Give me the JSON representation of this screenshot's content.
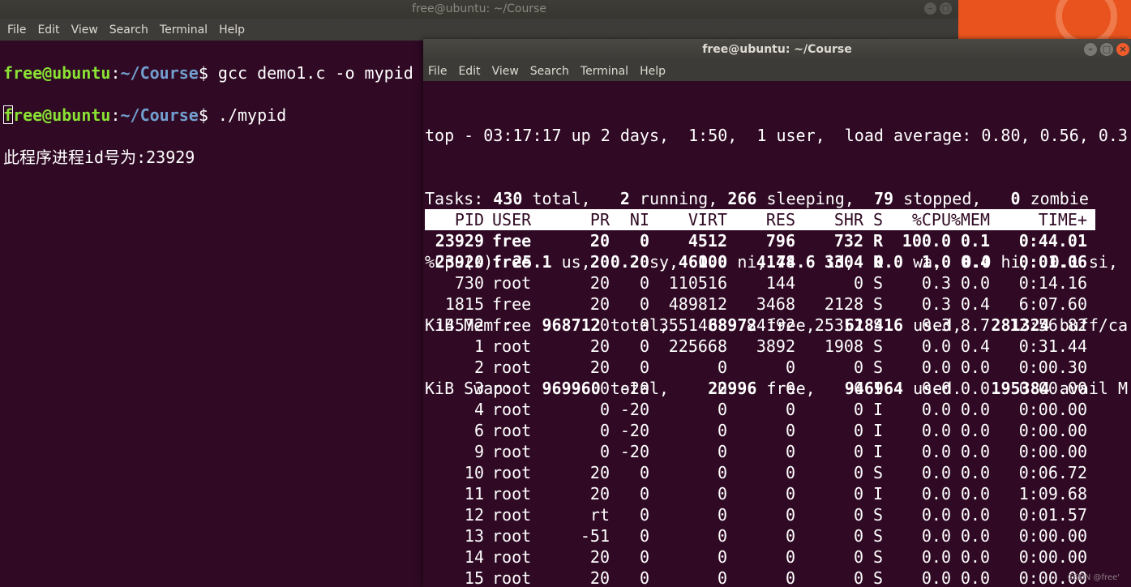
{
  "back_window": {
    "title": "free@ubuntu: ~/Course",
    "menu": [
      "File",
      "Edit",
      "View",
      "Search",
      "Terminal",
      "Help"
    ],
    "lines": [
      {
        "user": "free@ubuntu",
        "sep": ":",
        "path": "~/Course",
        "prompt": "$ ",
        "cmd": "gcc demo1.c -o mypid"
      },
      {
        "user": "free@ubuntu",
        "sep": ":",
        "path": "~/Course",
        "prompt": "$ ",
        "cmd": "./mypid"
      }
    ],
    "output": "此程序进程id号为:23929"
  },
  "front_window": {
    "title": "free@ubuntu: ~/Course",
    "menu": [
      "File",
      "Edit",
      "View",
      "Search",
      "Terminal",
      "Help"
    ],
    "summary": {
      "line1": "top - 03:17:17 up 2 days,  1:50,  1 user,  load average: 0.80, 0.56, 0.3",
      "tasks": {
        "prefix": "Tasks: ",
        "total": "430",
        "t_label": " total,   ",
        "running": "2",
        "r_label": " running, ",
        "sleeping": "266",
        "s_label": " sleeping,  ",
        "stopped": "79",
        "st_label": " stopped,   ",
        "zombie": "0",
        "z_label": " zombie"
      },
      "cpu": {
        "prefix": "%Cpu(s): ",
        "us": "25.1",
        "us_label": " us,  ",
        "sy": "0.2",
        "sy_label": " sy,  ",
        "ni": "0.0",
        "ni_label": " ni, ",
        "id": "74.6",
        "id_label": " id,  ",
        "wa": "0.0",
        "wa_label": " wa,  ",
        "hi": "0.0",
        "hi_label": " hi,  ",
        "si": "0.1",
        "si_label": " si,"
      },
      "mem": {
        "prefix": "KiB Mem :   ",
        "total": "968712",
        "t_label": " total,    ",
        "free": "68972",
        "f_label": " free,   ",
        "used": "618416",
        "u_label": " used,   ",
        "buff": "281324",
        "b_label": " buff/ca"
      },
      "swap": {
        "prefix": "KiB Swap:   ",
        "total": "969960",
        "t_label": " total,    ",
        "free": "22996",
        "f_label": " free,   ",
        "used": "946964",
        "u_label": " used.   ",
        "avail": "195384",
        "a_label": " avail M"
      }
    },
    "columns": [
      "PID",
      "USER",
      "PR",
      "NI",
      "VIRT",
      "RES",
      "SHR",
      "S",
      "%CPU",
      "%MEM",
      "TIME+"
    ],
    "processes": [
      {
        "pid": "23929",
        "user": "free",
        "pr": "20",
        "ni": "0",
        "virt": "4512",
        "res": "796",
        "shr": "732",
        "s": "R",
        "cpu": "100.0",
        "mem": "0.1",
        "time": "0:44.01",
        "bold": true
      },
      {
        "pid": "23920",
        "user": "free",
        "pr": "20",
        "ni": "0",
        "virt": "46100",
        "res": "4148",
        "shr": "3304",
        "s": "R",
        "cpu": "1.0",
        "mem": "0.4",
        "time": "0:01.06",
        "bold": true
      },
      {
        "pid": "730",
        "user": "root",
        "pr": "20",
        "ni": "0",
        "virt": "110516",
        "res": "144",
        "shr": "0",
        "s": "S",
        "cpu": "0.3",
        "mem": "0.0",
        "time": "0:14.16",
        "bold": false
      },
      {
        "pid": "1815",
        "user": "free",
        "pr": "20",
        "ni": "0",
        "virt": "489812",
        "res": "3468",
        "shr": "2128",
        "s": "S",
        "cpu": "0.3",
        "mem": "0.4",
        "time": "6:07.60",
        "bold": false
      },
      {
        "pid": "14572",
        "user": "free",
        "pr": "20",
        "ni": "0",
        "virt": "3551488",
        "res": "84192",
        "shr": "25352",
        "s": "S",
        "cpu": "0.3",
        "mem": "8.7",
        "time": "12:56.82",
        "bold": false
      },
      {
        "pid": "1",
        "user": "root",
        "pr": "20",
        "ni": "0",
        "virt": "225668",
        "res": "3892",
        "shr": "1908",
        "s": "S",
        "cpu": "0.0",
        "mem": "0.4",
        "time": "0:31.44",
        "bold": false
      },
      {
        "pid": "2",
        "user": "root",
        "pr": "20",
        "ni": "0",
        "virt": "0",
        "res": "0",
        "shr": "0",
        "s": "S",
        "cpu": "0.0",
        "mem": "0.0",
        "time": "0:00.30",
        "bold": false
      },
      {
        "pid": "3",
        "user": "root",
        "pr": "0",
        "ni": "-20",
        "virt": "0",
        "res": "0",
        "shr": "0",
        "s": "I",
        "cpu": "0.0",
        "mem": "0.0",
        "time": "0:00.00",
        "bold": false
      },
      {
        "pid": "4",
        "user": "root",
        "pr": "0",
        "ni": "-20",
        "virt": "0",
        "res": "0",
        "shr": "0",
        "s": "I",
        "cpu": "0.0",
        "mem": "0.0",
        "time": "0:00.00",
        "bold": false
      },
      {
        "pid": "6",
        "user": "root",
        "pr": "0",
        "ni": "-20",
        "virt": "0",
        "res": "0",
        "shr": "0",
        "s": "I",
        "cpu": "0.0",
        "mem": "0.0",
        "time": "0:00.00",
        "bold": false
      },
      {
        "pid": "9",
        "user": "root",
        "pr": "0",
        "ni": "-20",
        "virt": "0",
        "res": "0",
        "shr": "0",
        "s": "I",
        "cpu": "0.0",
        "mem": "0.0",
        "time": "0:00.00",
        "bold": false
      },
      {
        "pid": "10",
        "user": "root",
        "pr": "20",
        "ni": "0",
        "virt": "0",
        "res": "0",
        "shr": "0",
        "s": "S",
        "cpu": "0.0",
        "mem": "0.0",
        "time": "0:06.72",
        "bold": false
      },
      {
        "pid": "11",
        "user": "root",
        "pr": "20",
        "ni": "0",
        "virt": "0",
        "res": "0",
        "shr": "0",
        "s": "I",
        "cpu": "0.0",
        "mem": "0.0",
        "time": "1:09.68",
        "bold": false
      },
      {
        "pid": "12",
        "user": "root",
        "pr": "rt",
        "ni": "0",
        "virt": "0",
        "res": "0",
        "shr": "0",
        "s": "S",
        "cpu": "0.0",
        "mem": "0.0",
        "time": "0:01.57",
        "bold": false
      },
      {
        "pid": "13",
        "user": "root",
        "pr": "-51",
        "ni": "0",
        "virt": "0",
        "res": "0",
        "shr": "0",
        "s": "S",
        "cpu": "0.0",
        "mem": "0.0",
        "time": "0:00.00",
        "bold": false
      },
      {
        "pid": "14",
        "user": "root",
        "pr": "20",
        "ni": "0",
        "virt": "0",
        "res": "0",
        "shr": "0",
        "s": "S",
        "cpu": "0.0",
        "mem": "0.0",
        "time": "0:00.00",
        "bold": false
      },
      {
        "pid": "15",
        "user": "root",
        "pr": "20",
        "ni": "0",
        "virt": "0",
        "res": "0",
        "shr": "0",
        "s": "S",
        "cpu": "0.0",
        "mem": "0.0",
        "time": "0:00.00",
        "bold": false
      }
    ]
  },
  "watermark": "CSDN @free'",
  "window_buttons": {
    "minimize": "–",
    "maximize": "□",
    "close": "×"
  }
}
